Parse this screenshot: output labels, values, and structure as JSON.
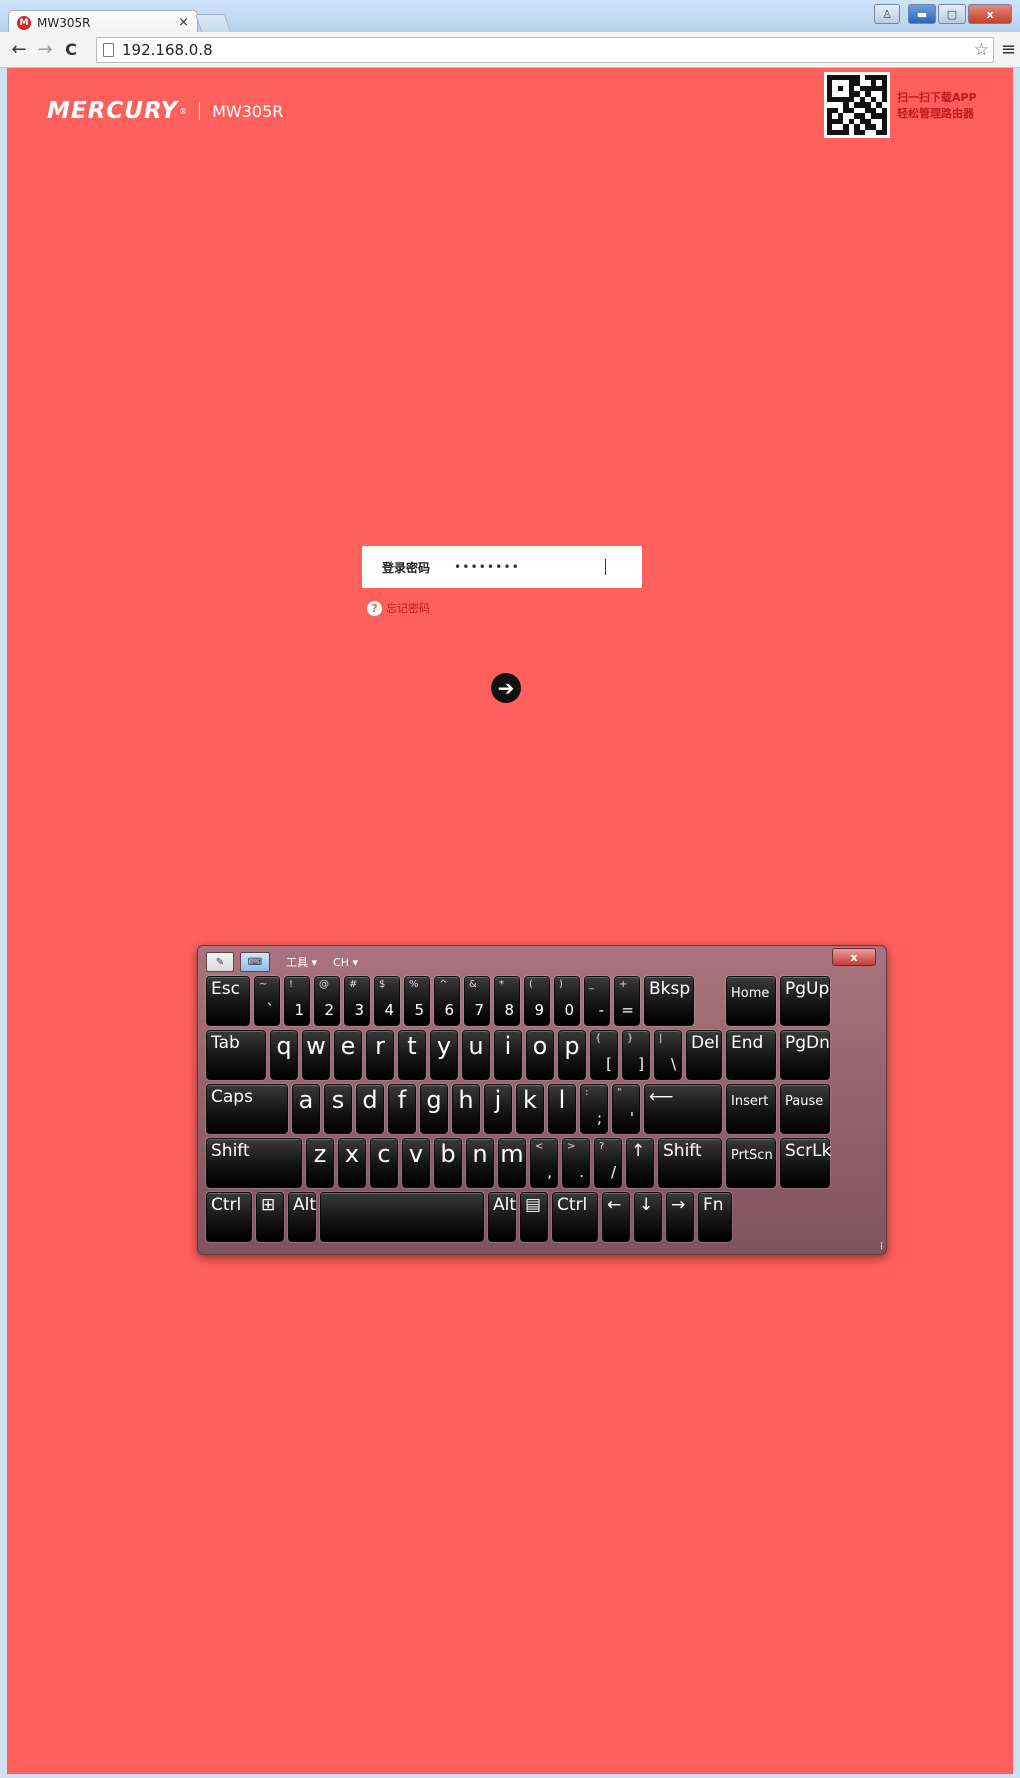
{
  "browser": {
    "tab_title": "MW305R",
    "tab_close": "×",
    "favicon": "M",
    "url": "192.168.0.8",
    "star": "☆",
    "menu": "≡",
    "back": "←",
    "forward": "→",
    "reload": "C"
  },
  "window": {
    "user": "♙",
    "minimize": "▬",
    "maximize": "▢",
    "close": "x"
  },
  "page": {
    "logo_word": "MERCURY",
    "logo_reg": "®",
    "model": "MW305R",
    "qr_text_line1": "扫一扫下载APP",
    "qr_text_line2": "轻松管理路由器",
    "login_label": "登录密码",
    "password_value": "••••••••",
    "forgot_icon": "?",
    "forgot_text": "忘记密码",
    "submit_icon": "➔"
  },
  "osk": {
    "tools_label": "工具 ▾",
    "lang_label": "CH ▾",
    "close": "x",
    "grip": "⁞",
    "keys": [
      {
        "id": "esc",
        "lbl": "Esc"
      },
      {
        "id": "tilde",
        "sh": "~",
        "mn": "`"
      },
      {
        "id": "1",
        "sh": "!",
        "mn": "1"
      },
      {
        "id": "2",
        "sh": "@",
        "mn": "2"
      },
      {
        "id": "3",
        "sh": "#",
        "mn": "3"
      },
      {
        "id": "4",
        "sh": "$",
        "mn": "4"
      },
      {
        "id": "5",
        "sh": "%",
        "mn": "5"
      },
      {
        "id": "6",
        "sh": "^",
        "mn": "6"
      },
      {
        "id": "7",
        "sh": "&",
        "mn": "7"
      },
      {
        "id": "8",
        "sh": "*",
        "mn": "8"
      },
      {
        "id": "9",
        "sh": "(",
        "mn": "9"
      },
      {
        "id": "0",
        "sh": ")",
        "mn": "0"
      },
      {
        "id": "minus",
        "sh": "_",
        "mn": "-"
      },
      {
        "id": "equal",
        "sh": "+",
        "mn": "="
      },
      {
        "id": "bksp",
        "lbl": "Bksp"
      },
      {
        "id": "home",
        "lbl": "Home"
      },
      {
        "id": "pgup",
        "lbl": "PgUp"
      },
      {
        "id": "tab",
        "lbl": "Tab"
      },
      {
        "id": "q",
        "lbl": "q"
      },
      {
        "id": "w",
        "lbl": "w"
      },
      {
        "id": "e",
        "lbl": "e"
      },
      {
        "id": "r",
        "lbl": "r"
      },
      {
        "id": "t",
        "lbl": "t"
      },
      {
        "id": "y",
        "lbl": "y"
      },
      {
        "id": "u",
        "lbl": "u"
      },
      {
        "id": "i",
        "lbl": "i"
      },
      {
        "id": "o",
        "lbl": "o"
      },
      {
        "id": "p",
        "lbl": "p"
      },
      {
        "id": "lbrace",
        "sh": "{",
        "mn": "["
      },
      {
        "id": "rbrace",
        "sh": "}",
        "mn": "]"
      },
      {
        "id": "pipe",
        "sh": "|",
        "mn": "\\"
      },
      {
        "id": "del",
        "lbl": "Del"
      },
      {
        "id": "end",
        "lbl": "End"
      },
      {
        "id": "pgdn",
        "lbl": "PgDn"
      },
      {
        "id": "caps",
        "lbl": "Caps"
      },
      {
        "id": "a",
        "lbl": "a"
      },
      {
        "id": "s",
        "lbl": "s"
      },
      {
        "id": "d",
        "lbl": "d"
      },
      {
        "id": "f",
        "lbl": "f"
      },
      {
        "id": "g",
        "lbl": "g"
      },
      {
        "id": "h",
        "lbl": "h"
      },
      {
        "id": "j",
        "lbl": "j"
      },
      {
        "id": "k",
        "lbl": "k"
      },
      {
        "id": "l",
        "lbl": "l"
      },
      {
        "id": "semi",
        "sh": ":",
        "mn": ";"
      },
      {
        "id": "quote",
        "sh": "\"",
        "mn": "'"
      },
      {
        "id": "enter",
        "lbl": "⟵"
      },
      {
        "id": "insert",
        "lbl": "Insert"
      },
      {
        "id": "pause",
        "lbl": "Pause"
      },
      {
        "id": "lshift",
        "lbl": "Shift"
      },
      {
        "id": "z",
        "lbl": "z"
      },
      {
        "id": "x",
        "lbl": "x"
      },
      {
        "id": "c",
        "lbl": "c"
      },
      {
        "id": "v",
        "lbl": "v"
      },
      {
        "id": "b",
        "lbl": "b"
      },
      {
        "id": "n",
        "lbl": "n"
      },
      {
        "id": "m",
        "lbl": "m"
      },
      {
        "id": "comma",
        "sh": "<",
        "mn": ","
      },
      {
        "id": "period",
        "sh": ">",
        "mn": "."
      },
      {
        "id": "slash",
        "sh": "?",
        "mn": "/"
      },
      {
        "id": "up",
        "lbl": "↑"
      },
      {
        "id": "rshift",
        "lbl": "Shift"
      },
      {
        "id": "prtscn",
        "lbl": "PrtScn"
      },
      {
        "id": "scrlk",
        "lbl": "ScrLk"
      },
      {
        "id": "lctrl",
        "lbl": "Ctrl"
      },
      {
        "id": "win",
        "lbl": "⊞"
      },
      {
        "id": "lalt",
        "lbl": "Alt"
      },
      {
        "id": "space",
        "lbl": ""
      },
      {
        "id": "ralt",
        "lbl": "Alt"
      },
      {
        "id": "appmenu",
        "lbl": "▤"
      },
      {
        "id": "rctrl",
        "lbl": "Ctrl"
      },
      {
        "id": "left",
        "lbl": "←"
      },
      {
        "id": "down",
        "lbl": "↓"
      },
      {
        "id": "right",
        "lbl": "→"
      },
      {
        "id": "fn",
        "lbl": "Fn"
      }
    ]
  }
}
